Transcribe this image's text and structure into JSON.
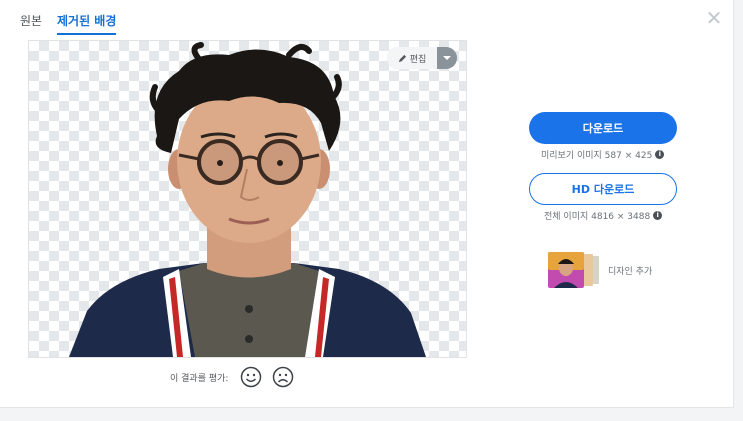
{
  "tabs": {
    "original": "원본",
    "removed_background": "제거된 배경"
  },
  "close": {
    "icon": "close-icon",
    "glyph": "✕"
  },
  "editor": {
    "edit_label": "편집",
    "edit_icon": "pencil-icon"
  },
  "download": {
    "button_label": "다운로드",
    "preview_note": "미리보기 이미지 587 × 425",
    "hd_button_label": "HD 다운로드",
    "full_note": "전체 이미지 4816 × 3488"
  },
  "design": {
    "label": "디자인 추가"
  },
  "rating": {
    "prompt": "이 결과를 평가:"
  },
  "colors": {
    "accent": "#1a73e8",
    "tab_active": "#1570d6"
  }
}
